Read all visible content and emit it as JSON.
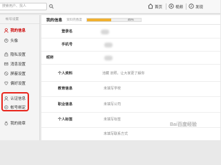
{
  "header": {
    "search_placeholder": "搜索用户、找人",
    "nav": [
      {
        "label": "首页",
        "icon": "home-icon"
      },
      {
        "label": "视频",
        "icon": "video-icon"
      },
      {
        "label": "发现",
        "icon": "discover-icon"
      }
    ]
  },
  "sidebar": {
    "heading": "帐号设置",
    "items": [
      {
        "label": "我的信息",
        "icon": "user-icon",
        "active": true
      },
      {
        "label": "头像",
        "icon": "avatar-icon"
      },
      {
        "label": "隐私设置",
        "icon": "privacy-icon"
      },
      {
        "label": "消息设置",
        "icon": "message-icon"
      },
      {
        "label": "屏蔽设置",
        "icon": "block-icon"
      },
      {
        "label": "偏好设置",
        "icon": "preference-icon"
      },
      {
        "label": "认证信息",
        "icon": "verify-icon"
      },
      {
        "label": "帐号绑定",
        "icon": "link-icon"
      },
      {
        "label": "我的勋章",
        "icon": "medal-icon"
      }
    ]
  },
  "profile": {
    "title": "我的信息",
    "progress_label": "资料完善度",
    "progress_value": "45%",
    "progress_fraction": 0.45
  },
  "rows": [
    {
      "label": "登录名",
      "value": ""
    },
    {
      "label": "手机号",
      "value": ""
    },
    {
      "label": "昵称",
      "value": ""
    },
    {
      "label": "个人资料",
      "value": "池藏 旧照，让大家更了解你"
    },
    {
      "label": "教育信息",
      "value": "未填写学校"
    },
    {
      "label": "职业信息",
      "value": "未填写公司"
    },
    {
      "label": "个人标签",
      "value": "未填写标签"
    },
    {
      "label": "",
      "value": "未填写联系方式"
    }
  ],
  "watermark": "Bai百度经验",
  "colors": {
    "accent": "#c00000",
    "highlight": "#e8231a",
    "progress": "#f0b030"
  }
}
